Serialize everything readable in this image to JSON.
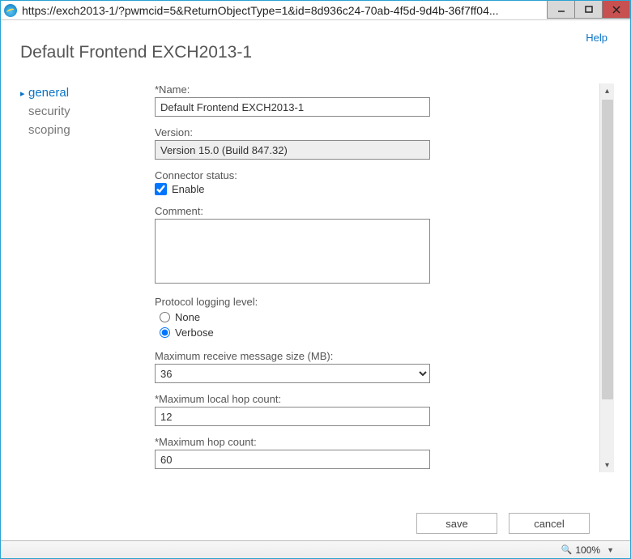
{
  "titlebar": {
    "url": "https://exch2013-1/?pwmcid=5&ReturnObjectType=1&id=8d936c24-70ab-4f5d-9d4b-36f7ff04..."
  },
  "help_label": "Help",
  "page_title": "Default Frontend EXCH2013-1",
  "sidebar": {
    "items": [
      {
        "label": "general",
        "active": true
      },
      {
        "label": "security",
        "active": false
      },
      {
        "label": "scoping",
        "active": false
      }
    ]
  },
  "form": {
    "name_label": "*Name:",
    "name_value": "Default Frontend EXCH2013-1",
    "version_label": "Version:",
    "version_value": "Version 15.0 (Build 847.32)",
    "connector_status_label": "Connector status:",
    "enable_label": "Enable",
    "enable_checked": true,
    "comment_label": "Comment:",
    "comment_value": "",
    "protocol_logging_label": "Protocol logging level:",
    "radio_none_label": "None",
    "radio_verbose_label": "Verbose",
    "logging_selected": "verbose",
    "max_recv_label": "Maximum receive message size (MB):",
    "max_recv_value": "36",
    "max_local_hop_label": "*Maximum local hop count:",
    "max_local_hop_value": "12",
    "max_hop_label": "*Maximum hop count:",
    "max_hop_value": "60"
  },
  "buttons": {
    "save": "save",
    "cancel": "cancel"
  },
  "statusbar": {
    "zoom": "100%"
  }
}
